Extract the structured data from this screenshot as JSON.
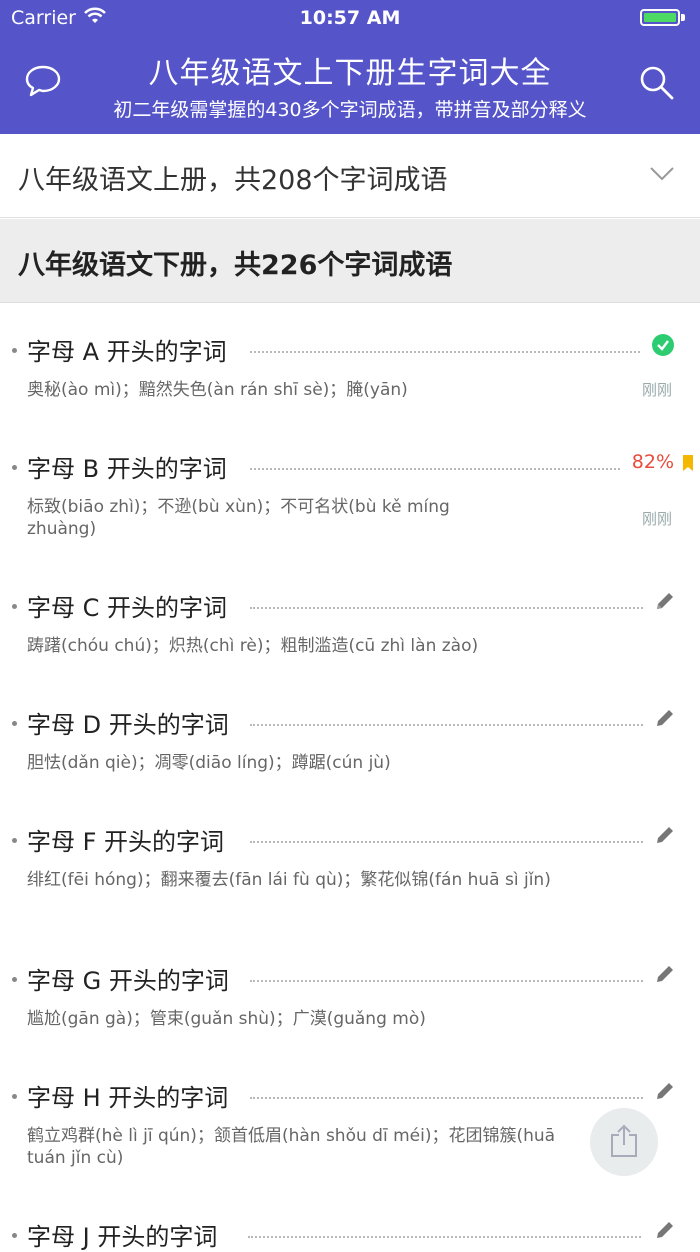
{
  "status_bar": {
    "carrier": "Carrier",
    "time": "10:57 AM"
  },
  "header": {
    "title": "八年级语文上下册生字词大全",
    "subtitle": "初二年级需掌握的430多个字词成语，带拼音及部分释义",
    "left_icon": "chat-bubble-icon",
    "right_icon": "search-icon"
  },
  "sections": [
    {
      "label": "八年级语文上册，共208个字词成语",
      "expanded": false
    },
    {
      "label": "八年级语文下册，共226个字词成语",
      "expanded": true
    }
  ],
  "items": [
    {
      "title": "字母 A 开头的字词",
      "words": "奥秘(ào mì)；黯然失色(àn rán shī sè)；腌(yān)",
      "time": "刚刚",
      "status": "completed"
    },
    {
      "title": "字母 B 开头的字词",
      "words": "标致(biāo zhì)；不逊(bù xùn)；不可名状(bù kě míng zhuàng)",
      "time": "刚刚",
      "progress": "82%",
      "status": "bookmarked"
    },
    {
      "title": "字母 C 开头的字词",
      "words": "踌躇(chóu chú)；炽热(chì rè)；粗制滥造(cū zhì làn zào)",
      "status": "edit"
    },
    {
      "title": "字母 D 开头的字词",
      "words": "胆怯(dǎn qiè)；凋零(diāo líng)；蹲踞(cún jù)",
      "status": "edit"
    },
    {
      "title": "字母 F 开头的字词",
      "words": "绯红(fēi hóng)；翻来覆去(fān lái fù qù)；繁花似锦(fán huā sì jǐn)",
      "status": "edit"
    },
    {
      "title": "字母 G 开头的字词",
      "words": "尴尬(gān gà)；管束(guǎn shù)；广漠(guǎng mò)",
      "status": "edit"
    },
    {
      "title": "字母 H 开头的字词",
      "words": "鹤立鸡群(hè lì jī qún)；颔首低眉(hàn shǒu dī méi)；花团锦簇(huā tuán jǐn cù)",
      "status": "edit"
    },
    {
      "title": "字母 J 开头的字词",
      "words": "",
      "status": "edit"
    }
  ],
  "colors": {
    "header": "#5554c9",
    "completed": "#2ecc71",
    "progress": "#e74c3c",
    "bookmark": "#f5b800"
  },
  "share_icon": "share-icon"
}
